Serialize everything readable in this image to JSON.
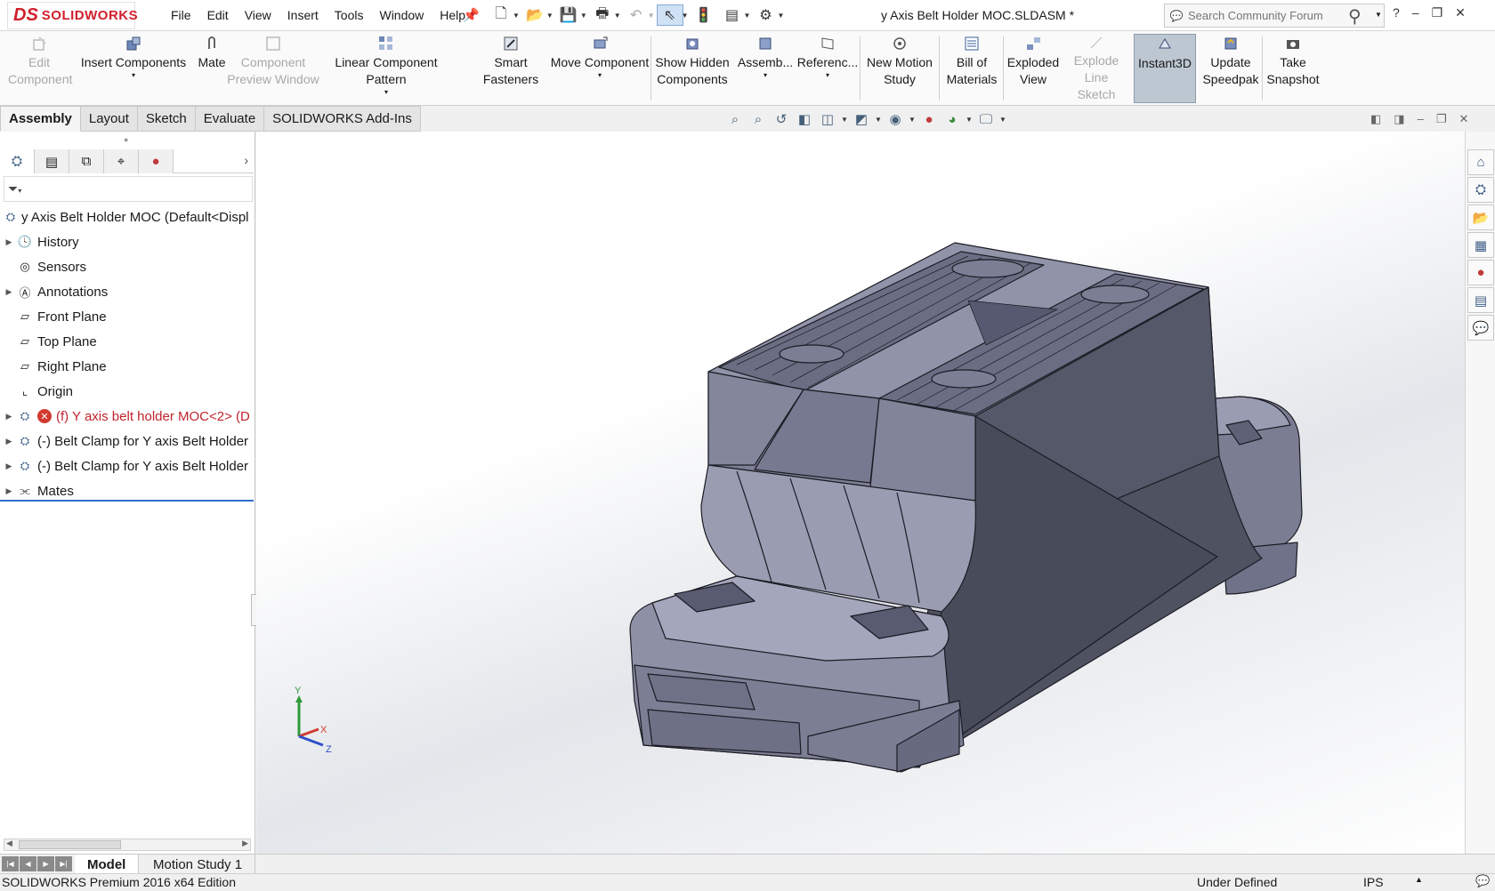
{
  "app": {
    "brand": "SOLIDWORKS",
    "brand_mark": "DS",
    "document_title": "y Axis Belt Holder MOC.SLDASM *"
  },
  "menu": [
    "File",
    "Edit",
    "View",
    "Insert",
    "Tools",
    "Window",
    "Help"
  ],
  "search": {
    "placeholder": "Search Community Forum"
  },
  "window_controls": {
    "help": "?",
    "minimize": "–",
    "restore": "❐",
    "close": "✕"
  },
  "command_manager": {
    "edit_component": "Edit Component",
    "insert_components": "Insert Components",
    "mate": "Mate",
    "component_preview": "Component Preview Window",
    "linear_pattern": "Linear Component Pattern",
    "smart_fasteners": "Smart Fasteners",
    "move_component": "Move Component",
    "show_hidden": "Show Hidden Components",
    "assembly_features": "Assemb...",
    "reference_geometry": "Referenc...",
    "new_motion_study": "New Motion Study",
    "bill_of_materials": "Bill of Materials",
    "exploded_view": "Exploded View",
    "explode_line_sketch": "Explode Line Sketch",
    "instant3d": "Instant3D",
    "update_speedpak": "Update Speedpak",
    "take_snapshot": "Take Snapshot"
  },
  "tabs": [
    {
      "label": "Assembly",
      "active": true
    },
    {
      "label": "Layout",
      "active": false
    },
    {
      "label": "Sketch",
      "active": false
    },
    {
      "label": "Evaluate",
      "active": false
    },
    {
      "label": "SOLIDWORKS Add-Ins",
      "active": false
    }
  ],
  "feature_tree": {
    "root": "y Axis Belt Holder MOC  (Default<Displ",
    "items": [
      {
        "label": "History",
        "icon": "history-icon",
        "expandable": true
      },
      {
        "label": "Sensors",
        "icon": "sensors-icon",
        "expandable": false
      },
      {
        "label": "Annotations",
        "icon": "annotations-icon",
        "expandable": true
      },
      {
        "label": "Front Plane",
        "icon": "plane-icon",
        "expandable": false
      },
      {
        "label": "Top Plane",
        "icon": "plane-icon",
        "expandable": false
      },
      {
        "label": "Right Plane",
        "icon": "plane-icon",
        "expandable": false
      },
      {
        "label": "Origin",
        "icon": "origin-icon",
        "expandable": false
      },
      {
        "label": "(f) Y axis belt holder MOC<2> (D",
        "icon": "part-icon",
        "expandable": true,
        "error": true
      },
      {
        "label": "(-) Belt Clamp for Y axis Belt Holder",
        "icon": "part-icon",
        "expandable": true
      },
      {
        "label": "(-) Belt Clamp for Y axis Belt Holder",
        "icon": "part-icon",
        "expandable": true
      },
      {
        "label": "Mates",
        "icon": "mates-icon",
        "expandable": true
      }
    ]
  },
  "triad": {
    "x": "X",
    "y": "Y",
    "z": "Z"
  },
  "bottom_tabs": [
    {
      "label": "Model",
      "active": true
    },
    {
      "label": "Motion Study 1",
      "active": false
    }
  ],
  "status": {
    "edition": "SOLIDWORKS Premium 2016 x64 Edition",
    "state": "Under Defined",
    "units": "IPS"
  },
  "colors": {
    "accent": "#2e6fc9",
    "error": "#c0242e",
    "model": "#6e7186"
  }
}
